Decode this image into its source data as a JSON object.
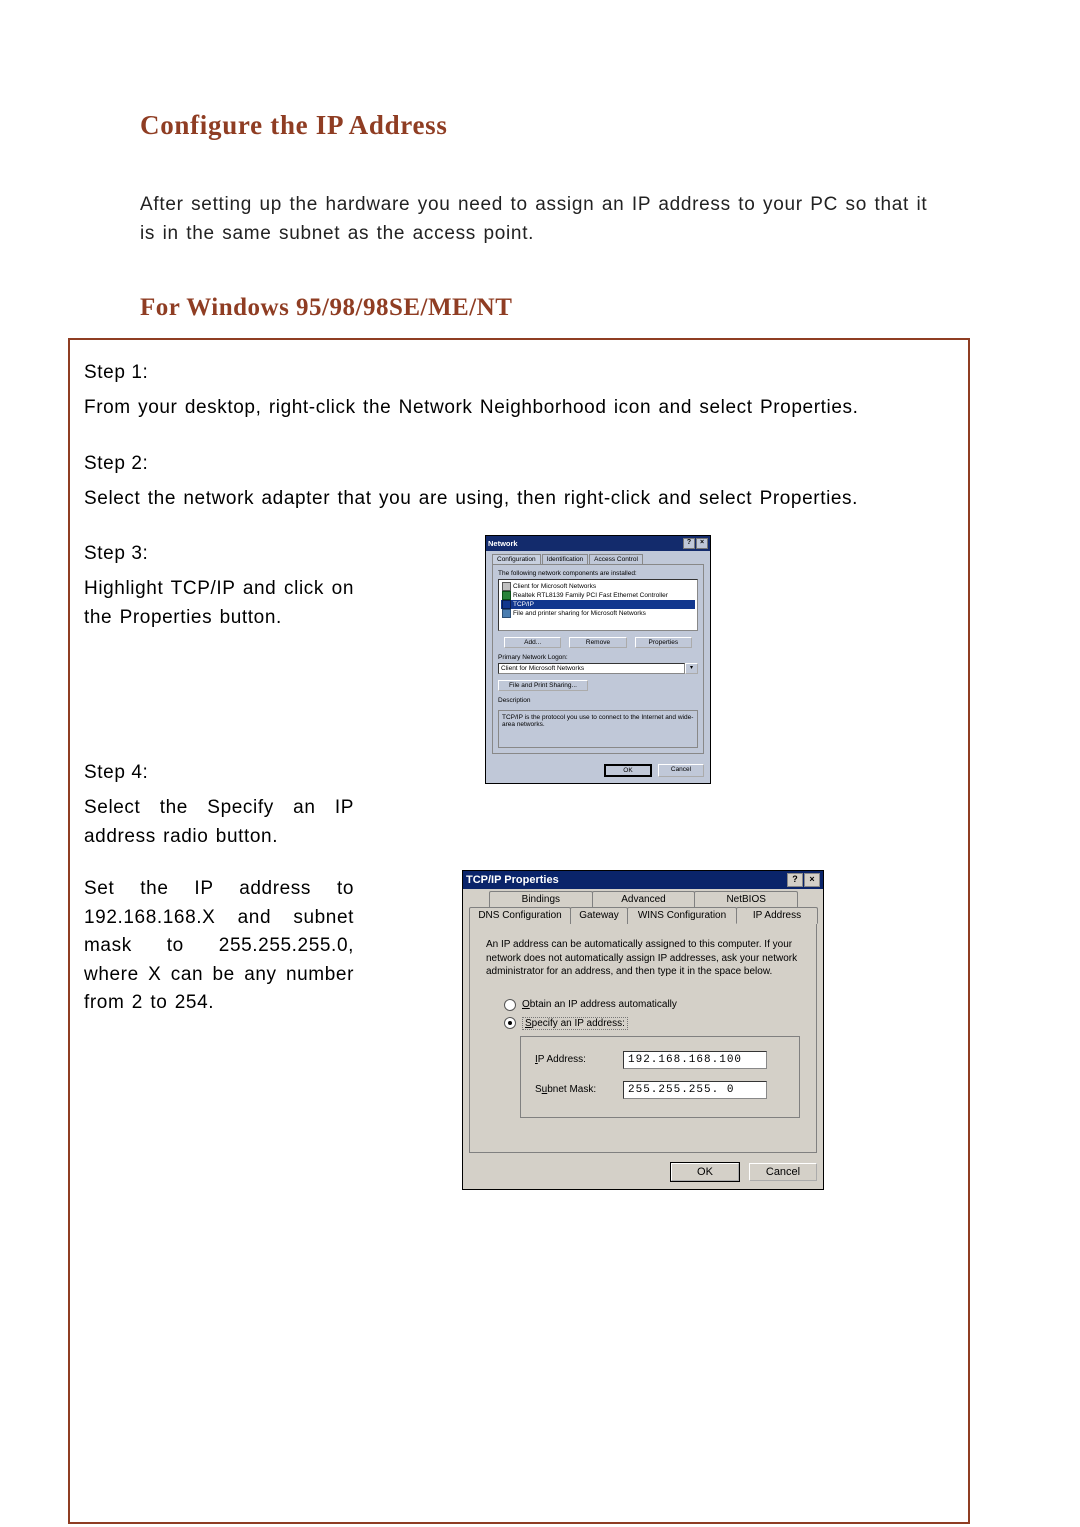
{
  "heading1": "Configure the IP Address",
  "intro": "After setting up the hardware you need to assign an IP address to your PC so that it is in the same subnet as the access point.",
  "heading2": "For Windows 95/98/98SE/ME/NT",
  "steps": {
    "s1_label": "Step 1:",
    "s1_text": "From your desktop, right-click the Network Neighborhood icon and select Properties.",
    "s2_label": "Step 2:",
    "s2_text": "Select the network adapter that you are using, then right-click and select Properties.",
    "s3_label": "Step 3:",
    "s3_text": "Highlight TCP/IP and click on the Properties button.",
    "s4_label": "Step 4:",
    "s4_text1": "Select the Specify an IP address radio button.",
    "s4_text2": "Set the IP address to 192.168.168.X and subnet mask to 255.255.255.0, where X can be any number from 2 to 254."
  },
  "network_dialog": {
    "title": "Network",
    "help_btn": "?",
    "close_btn": "×",
    "tabs": {
      "configuration": "Configuration",
      "identification": "Identification",
      "access": "Access Control"
    },
    "list_label": "The following network components are installed:",
    "items": {
      "i0": "Client for Microsoft Networks",
      "i1": "Realtek RTL8139 Family PCI Fast Ethernet Controller",
      "i2": "TCP/IP",
      "i3": "File and printer sharing for Microsoft Networks"
    },
    "add_btn": "Add...",
    "remove_btn": "Remove",
    "properties_btn": "Properties",
    "logon_label": "Primary Network Logon:",
    "logon_value": "Client for Microsoft Networks",
    "fileshare_btn": "File and Print Sharing...",
    "desc_label": "Description",
    "desc_text": "TCP/IP is the protocol you use to connect to the Internet and wide-area networks.",
    "ok": "OK",
    "cancel": "Cancel"
  },
  "tcpip_dialog": {
    "title": "TCP/IP Properties",
    "help_btn": "?",
    "close_btn": "×",
    "tabs_row1": {
      "bindings": "Bindings",
      "advanced": "Advanced",
      "netbios": "NetBIOS"
    },
    "tabs_row2": {
      "dns": "DNS Configuration",
      "gateway": "Gateway",
      "wins": "WINS Configuration",
      "ip": "IP Address"
    },
    "info": "An IP address can be automatically assigned to this computer. If your network does not automatically assign IP addresses, ask your network administrator for an address, and then type it in the space below.",
    "radio_obtain_pre": "O",
    "radio_obtain_rest": "btain an IP address automatically",
    "radio_specify_pre": "S",
    "radio_specify_rest": "pecify an IP address:",
    "ip_pre": "I",
    "ip_rest": "P Address:",
    "subnet_label_1": "S",
    "subnet_label_u": "u",
    "subnet_label_2": "bnet Mask:",
    "ip_value": "192.168.168.100",
    "subnet_value": "255.255.255. 0 ",
    "ok": "OK",
    "cancel": "Cancel"
  }
}
